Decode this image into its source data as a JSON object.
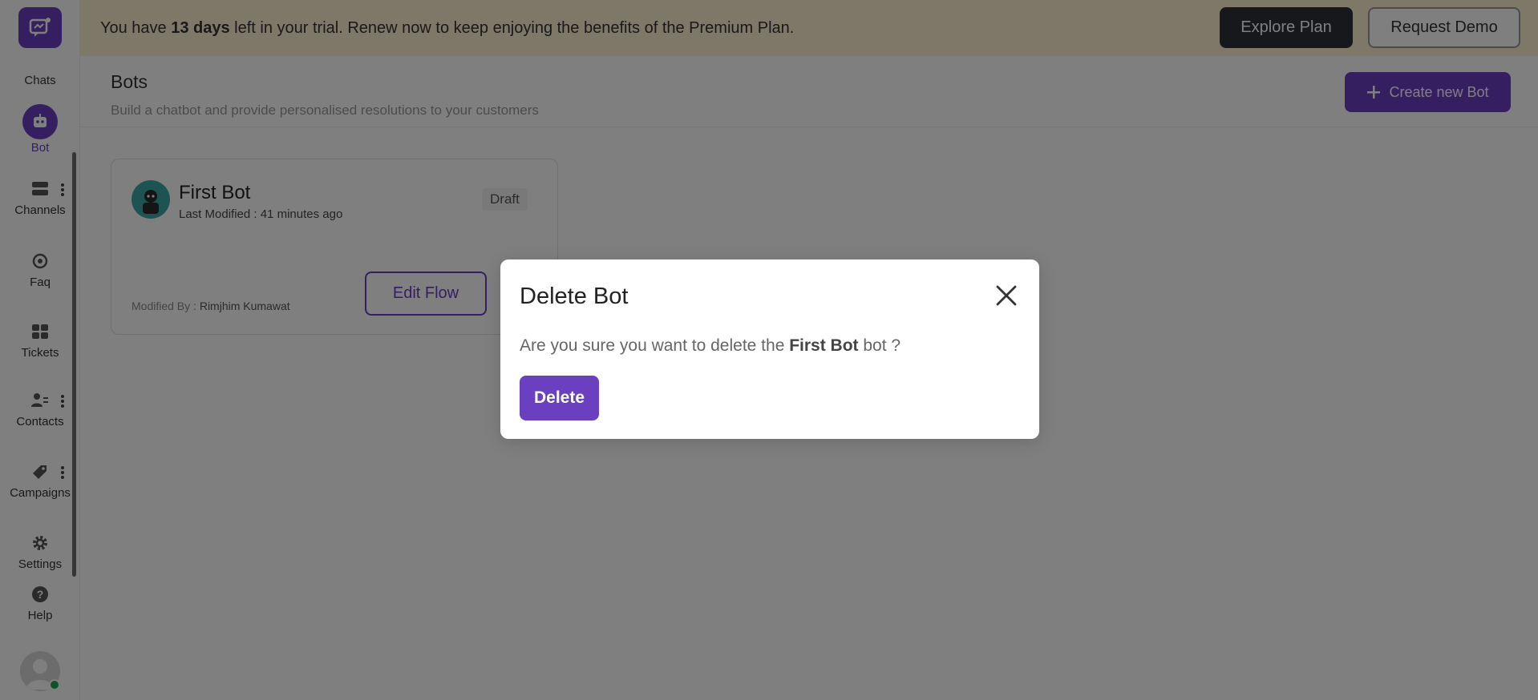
{
  "sidebar": {
    "items": [
      {
        "label": "Chats",
        "icon": "chats-icon"
      },
      {
        "label": "Bot",
        "icon": "bot-icon",
        "active": true
      },
      {
        "label": "Channels",
        "icon": "channels-icon"
      },
      {
        "label": "Faq",
        "icon": "faq-icon"
      },
      {
        "label": "Tickets",
        "icon": "tickets-icon"
      },
      {
        "label": "Contacts",
        "icon": "contacts-icon"
      },
      {
        "label": "Campaigns",
        "icon": "campaigns-icon"
      },
      {
        "label": "Settings",
        "icon": "settings-icon"
      },
      {
        "label": "Help",
        "icon": "help-icon"
      }
    ]
  },
  "banner": {
    "text_pre": "You have ",
    "text_bold": "13 days",
    "text_post": " left in your trial. Renew now to keep enjoying the benefits of the Premium Plan.",
    "explore_label": "Explore Plan",
    "demo_label": "Request Demo"
  },
  "page": {
    "title": "Bots",
    "subtitle": "Build a chatbot and provide personalised resolutions to your customers",
    "create_label": "Create new Bot"
  },
  "card": {
    "name": "First Bot",
    "last_modified": "Last Modified : 41 minutes ago",
    "status": "Draft",
    "modified_by_label": "Modified By : ",
    "modified_by_name": "Rimjhim Kumawat",
    "edit_label": "Edit Flow"
  },
  "modal": {
    "title": "Delete Bot",
    "msg_pre": "Are you sure you want to delete the ",
    "msg_bold": "First Bot",
    "msg_post": " bot ?",
    "delete_label": "Delete"
  },
  "colors": {
    "accent": "#6a3fc0",
    "banner_bg": "#fbf1cf",
    "online": "#1aa64b"
  }
}
